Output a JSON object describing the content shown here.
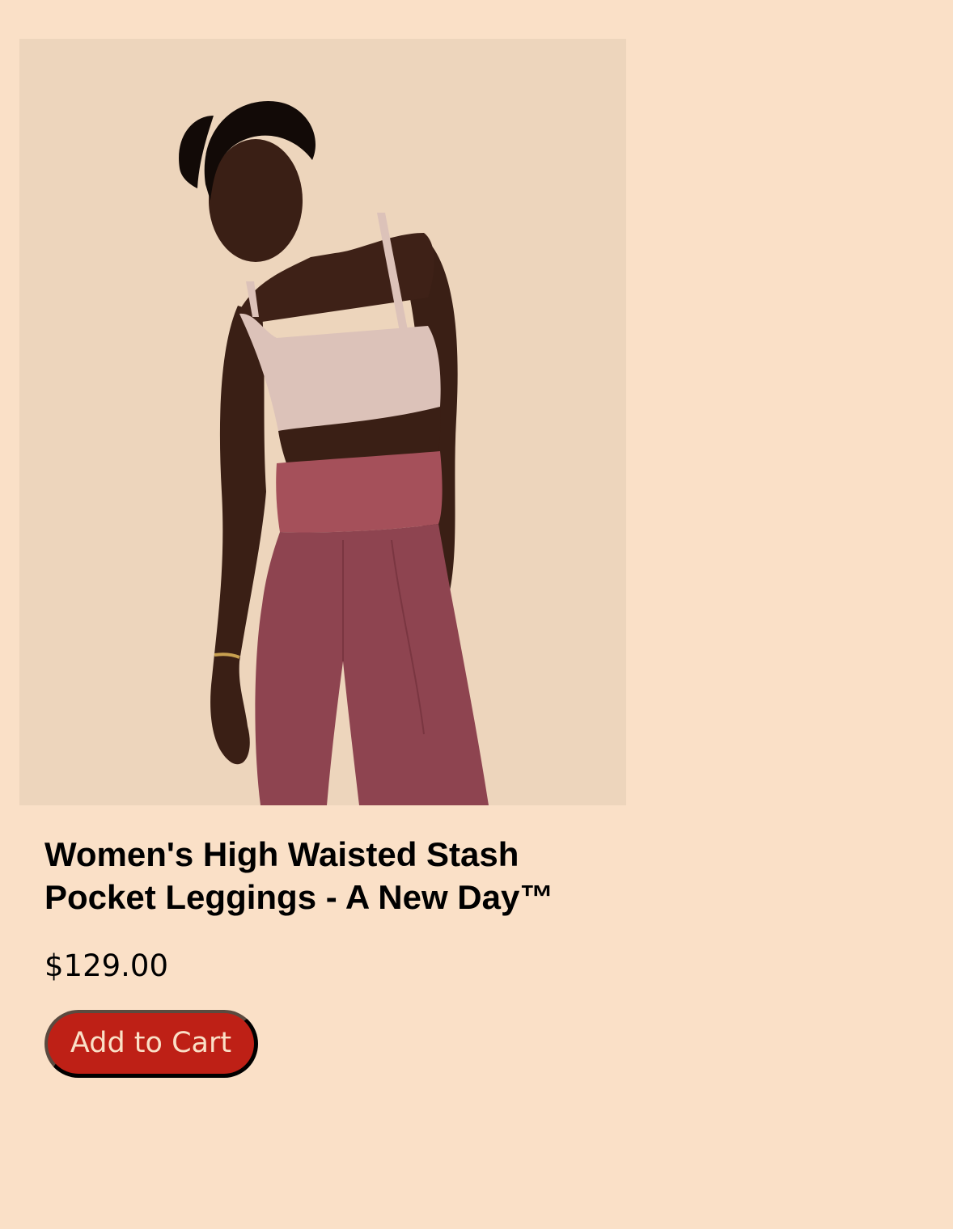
{
  "product": {
    "image_alt": "Woman wearing a light pink cropped tank top and rose-colored high waisted leggings",
    "title": "Women's High Waisted Stash Pocket Leggings - A New Day™",
    "price": "$129.00",
    "add_to_cart_label": "Add to Cart"
  },
  "colors": {
    "page_background": "#fae0c7",
    "image_background": "#edd5bc",
    "button_background": "#be2016",
    "button_text": "#fae0c7"
  }
}
